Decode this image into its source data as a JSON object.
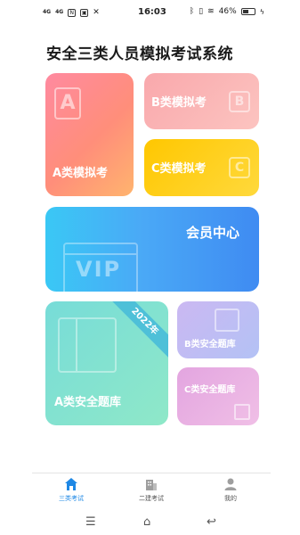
{
  "status_bar": {
    "signal_1": "4G",
    "signal_2": "4G",
    "time": "16:03",
    "battery": "46%"
  },
  "page": {
    "title": "安全三类人员模拟考试系统"
  },
  "cards": {
    "a_exam": {
      "label": "A类模拟考",
      "icon_letter": "A"
    },
    "b_exam": {
      "label": "B类模拟考",
      "icon_letter": "B"
    },
    "c_exam": {
      "label": "C类模拟考",
      "icon_letter": "C"
    },
    "member": {
      "label": "会员中心",
      "icon_text": "VIP"
    },
    "a_bank": {
      "label": "A类安全题库",
      "ribbon": "2022年"
    },
    "b_bank": {
      "label": "B类安全题库"
    },
    "c_bank": {
      "label": "C类安全题库"
    }
  },
  "tabs": [
    {
      "label": "三类考试",
      "icon": "home-icon",
      "active": true
    },
    {
      "label": "二建考试",
      "icon": "building-icon",
      "active": false
    },
    {
      "label": "我的",
      "icon": "user-icon",
      "active": false
    }
  ],
  "colors": {
    "active_tab": "#1e88e5",
    "inactive_tab": "#9e9e9e"
  }
}
